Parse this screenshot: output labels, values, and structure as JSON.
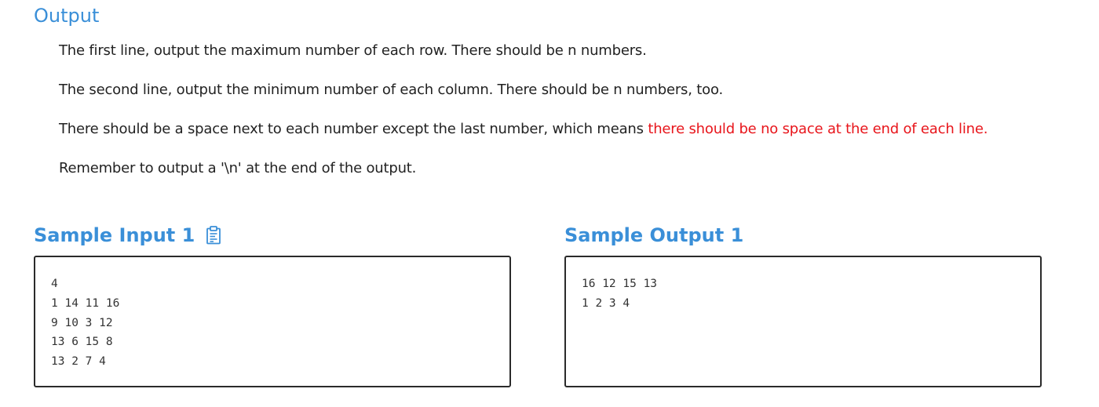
{
  "output_section": {
    "title": "Output",
    "paragraphs": [
      "The first line, output the maximum number of each row. There should be n numbers.",
      "The second line, output the minimum number of each column. There should be n numbers, too.",
      "Remember to output a '\\n' at the end of the output."
    ],
    "spacing_paragraph": {
      "text": "There should be a space next to each number except the last number, which means ",
      "highlight": "there should be no space at the end of each line."
    }
  },
  "sample_input": {
    "title": "Sample Input 1",
    "copy_icon": "clipboard-icon",
    "content": "4\n1 14 11 16\n9 10 3 12\n13 6 15 8\n13 2 7 4"
  },
  "sample_output": {
    "title": "Sample Output 1",
    "content": "16 12 15 13\n1 2 3 4"
  },
  "colors": {
    "heading": "#3a8fd8",
    "highlight": "#e8151b",
    "box_border": "#2a2a2a"
  }
}
